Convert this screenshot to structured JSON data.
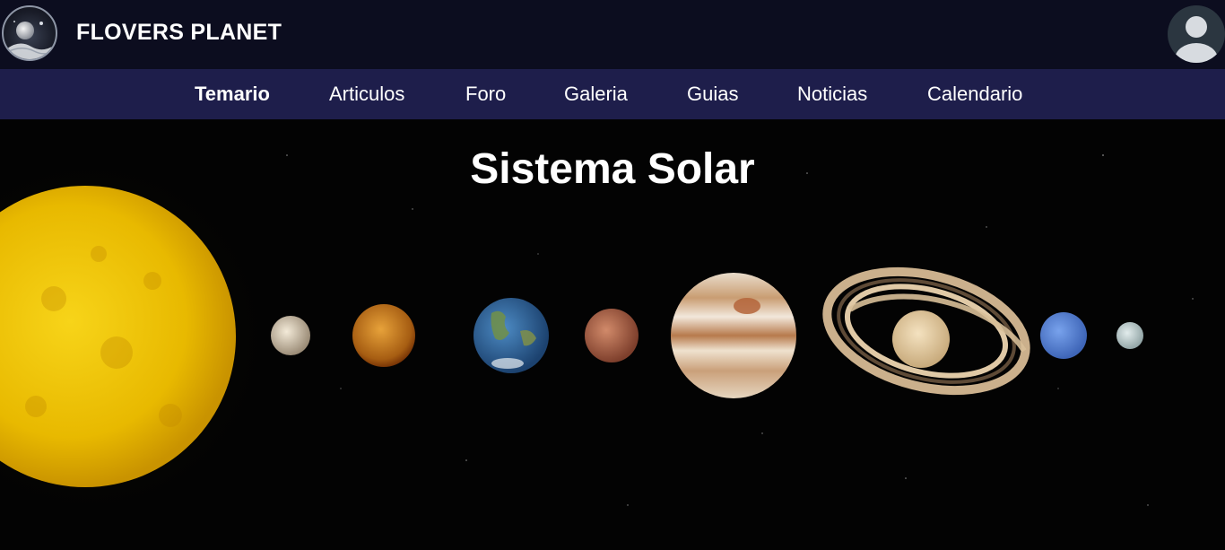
{
  "header": {
    "brand": "FLOVERS PLANET",
    "logo_icon": "moon-logo-icon",
    "avatar_icon": "user-avatar-icon"
  },
  "nav": {
    "items": [
      {
        "label": "Temario",
        "active": true
      },
      {
        "label": "Articulos",
        "active": false
      },
      {
        "label": "Foro",
        "active": false
      },
      {
        "label": "Galeria",
        "active": false
      },
      {
        "label": "Guias",
        "active": false
      },
      {
        "label": "Noticias",
        "active": false
      },
      {
        "label": "Calendario",
        "active": false
      }
    ]
  },
  "hero": {
    "title": "Sistema Solar",
    "bodies": [
      "Sun",
      "Mercury",
      "Venus",
      "Earth",
      "Mars",
      "Jupiter",
      "Saturn",
      "Uranus",
      "Neptune"
    ]
  },
  "colors": {
    "topbar": "#0c0d1f",
    "navbar": "#1e1e4b",
    "hero_background": "#030303",
    "text": "#ffffff"
  }
}
